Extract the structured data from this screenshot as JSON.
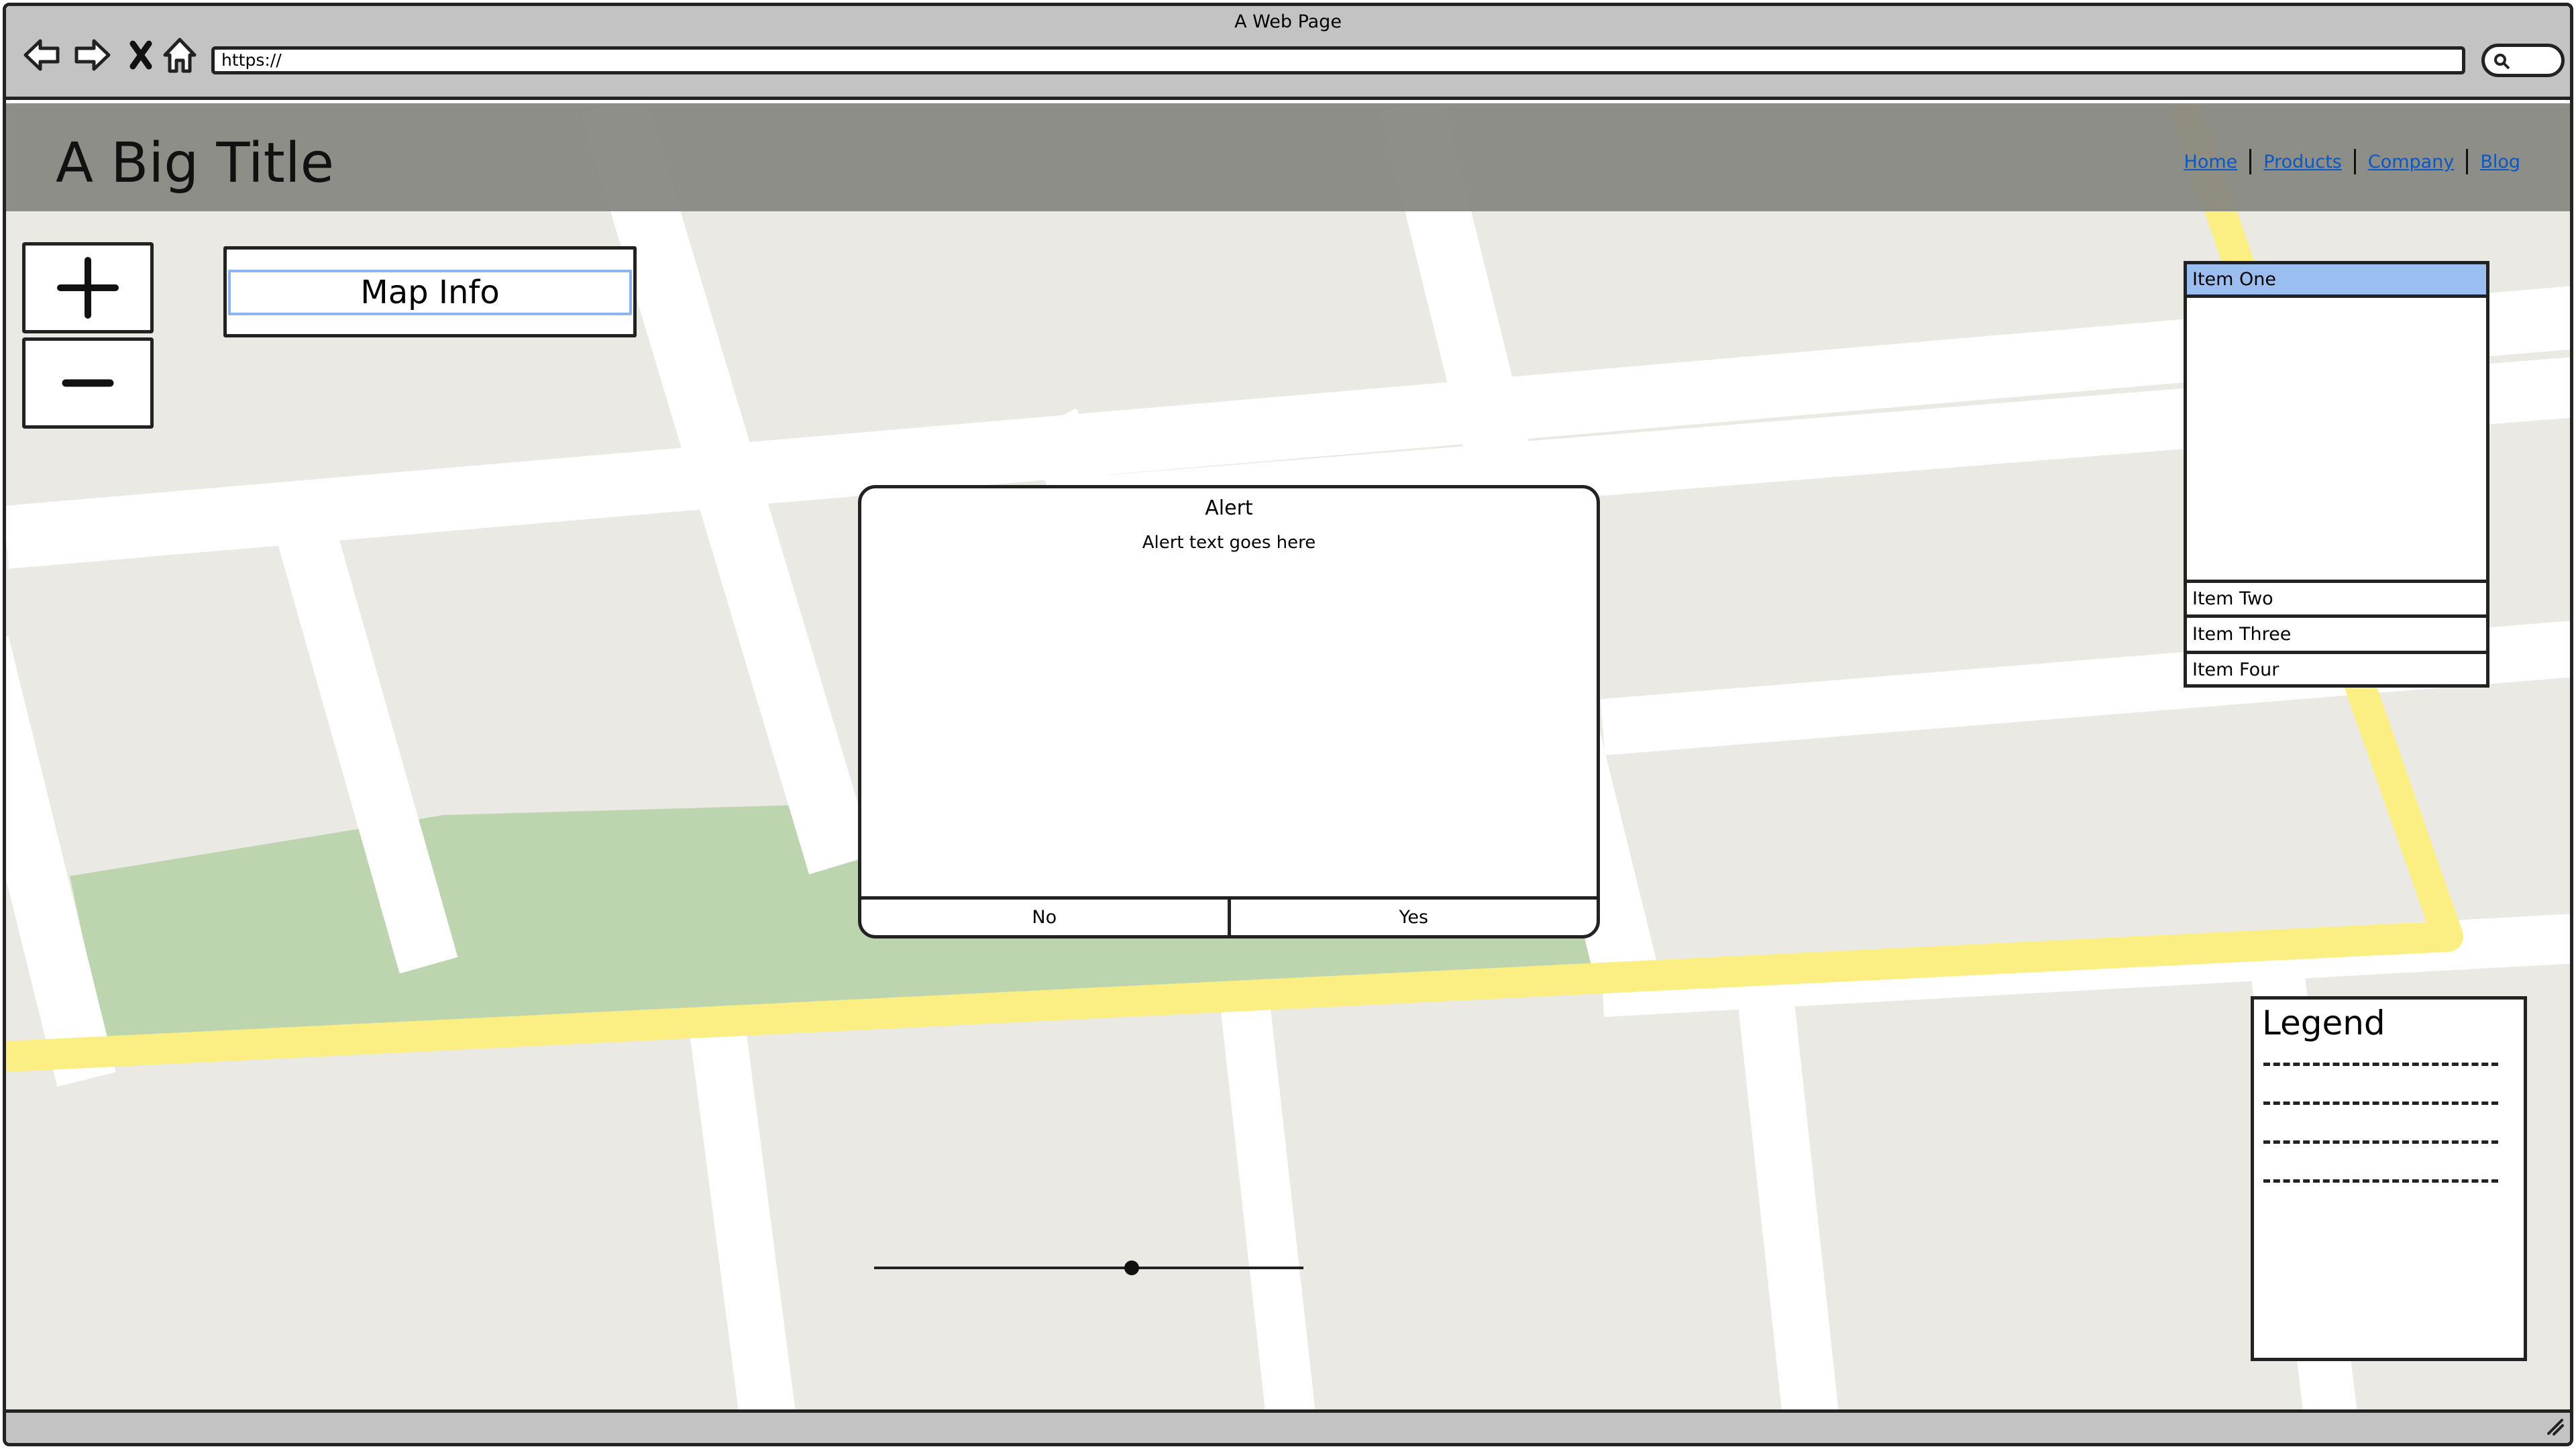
{
  "browser": {
    "window_title": "A Web Page",
    "url": "https://",
    "nav_icons": [
      "back-arrow-icon",
      "forward-arrow-icon",
      "close-x-icon",
      "home-icon"
    ],
    "search_icon": "search-icon"
  },
  "header": {
    "title": "A Big Title",
    "nav": [
      "Home",
      "Products",
      "Company",
      "Blog"
    ],
    "link_color": "#0b57c4"
  },
  "zoom": {
    "in_icon": "plus-icon",
    "out_icon": "minus-icon"
  },
  "map_info": {
    "label": "Map Info"
  },
  "list": {
    "items": [
      "Item One",
      "Item Two",
      "Item Three",
      "Item Four"
    ],
    "selected_index": 0,
    "selected_color": "#9bbef0"
  },
  "alert": {
    "title": "Alert",
    "text": "Alert text goes here",
    "no_label": "No",
    "yes_label": "Yes"
  },
  "slider": {
    "value": 0.6
  },
  "legend": {
    "title": "Legend",
    "entries": 4
  },
  "map_colors": {
    "land": "#ebe9e3",
    "road": "#ffffff",
    "park": "#bdd5ae",
    "highway": "#fbee82"
  }
}
